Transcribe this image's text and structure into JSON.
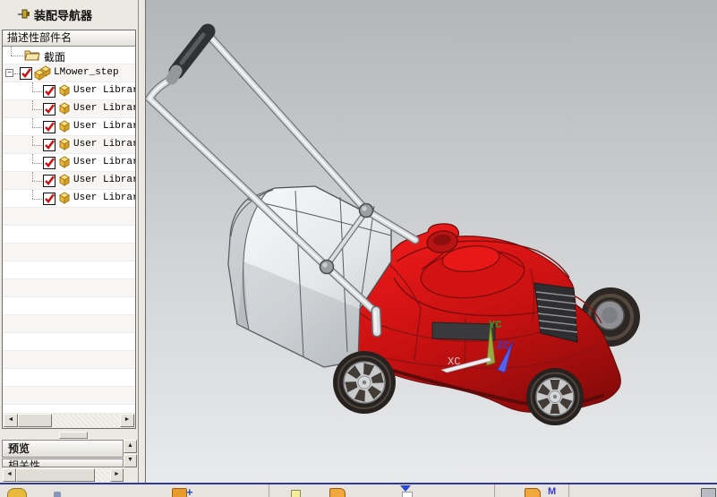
{
  "panel": {
    "title": "装配导航器",
    "column_header": "描述性部件名",
    "tree": {
      "section_label": "截面",
      "assembly_label": "LMower_step",
      "assembly_checked": true,
      "items": [
        "User Library",
        "User Library",
        "User Library",
        "User Library",
        "User Library",
        "User Library",
        "User Library"
      ],
      "items_checked": true
    },
    "preview_label": "预览",
    "dependencies_label": "相关性"
  },
  "viewport": {
    "triad": {
      "x": "XC",
      "y": "YC",
      "z": "ZC"
    }
  },
  "icons": {
    "scroll_left": "◄",
    "scroll_right": "►",
    "scroll_up": "▲",
    "scroll_down": "▼",
    "expand_collapse": "−"
  },
  "colors": {
    "mower_red": "#c51010",
    "check_red": "#cf1212",
    "viewport_top": "#b3b5b9",
    "viewport_bottom": "#e9eaeb",
    "taskbar_line": "#2e3a96",
    "triad_y_green": "#2f9e2f",
    "triad_z_blue": "#3a3acc",
    "triad_x_gray": "#cfd2d5"
  }
}
